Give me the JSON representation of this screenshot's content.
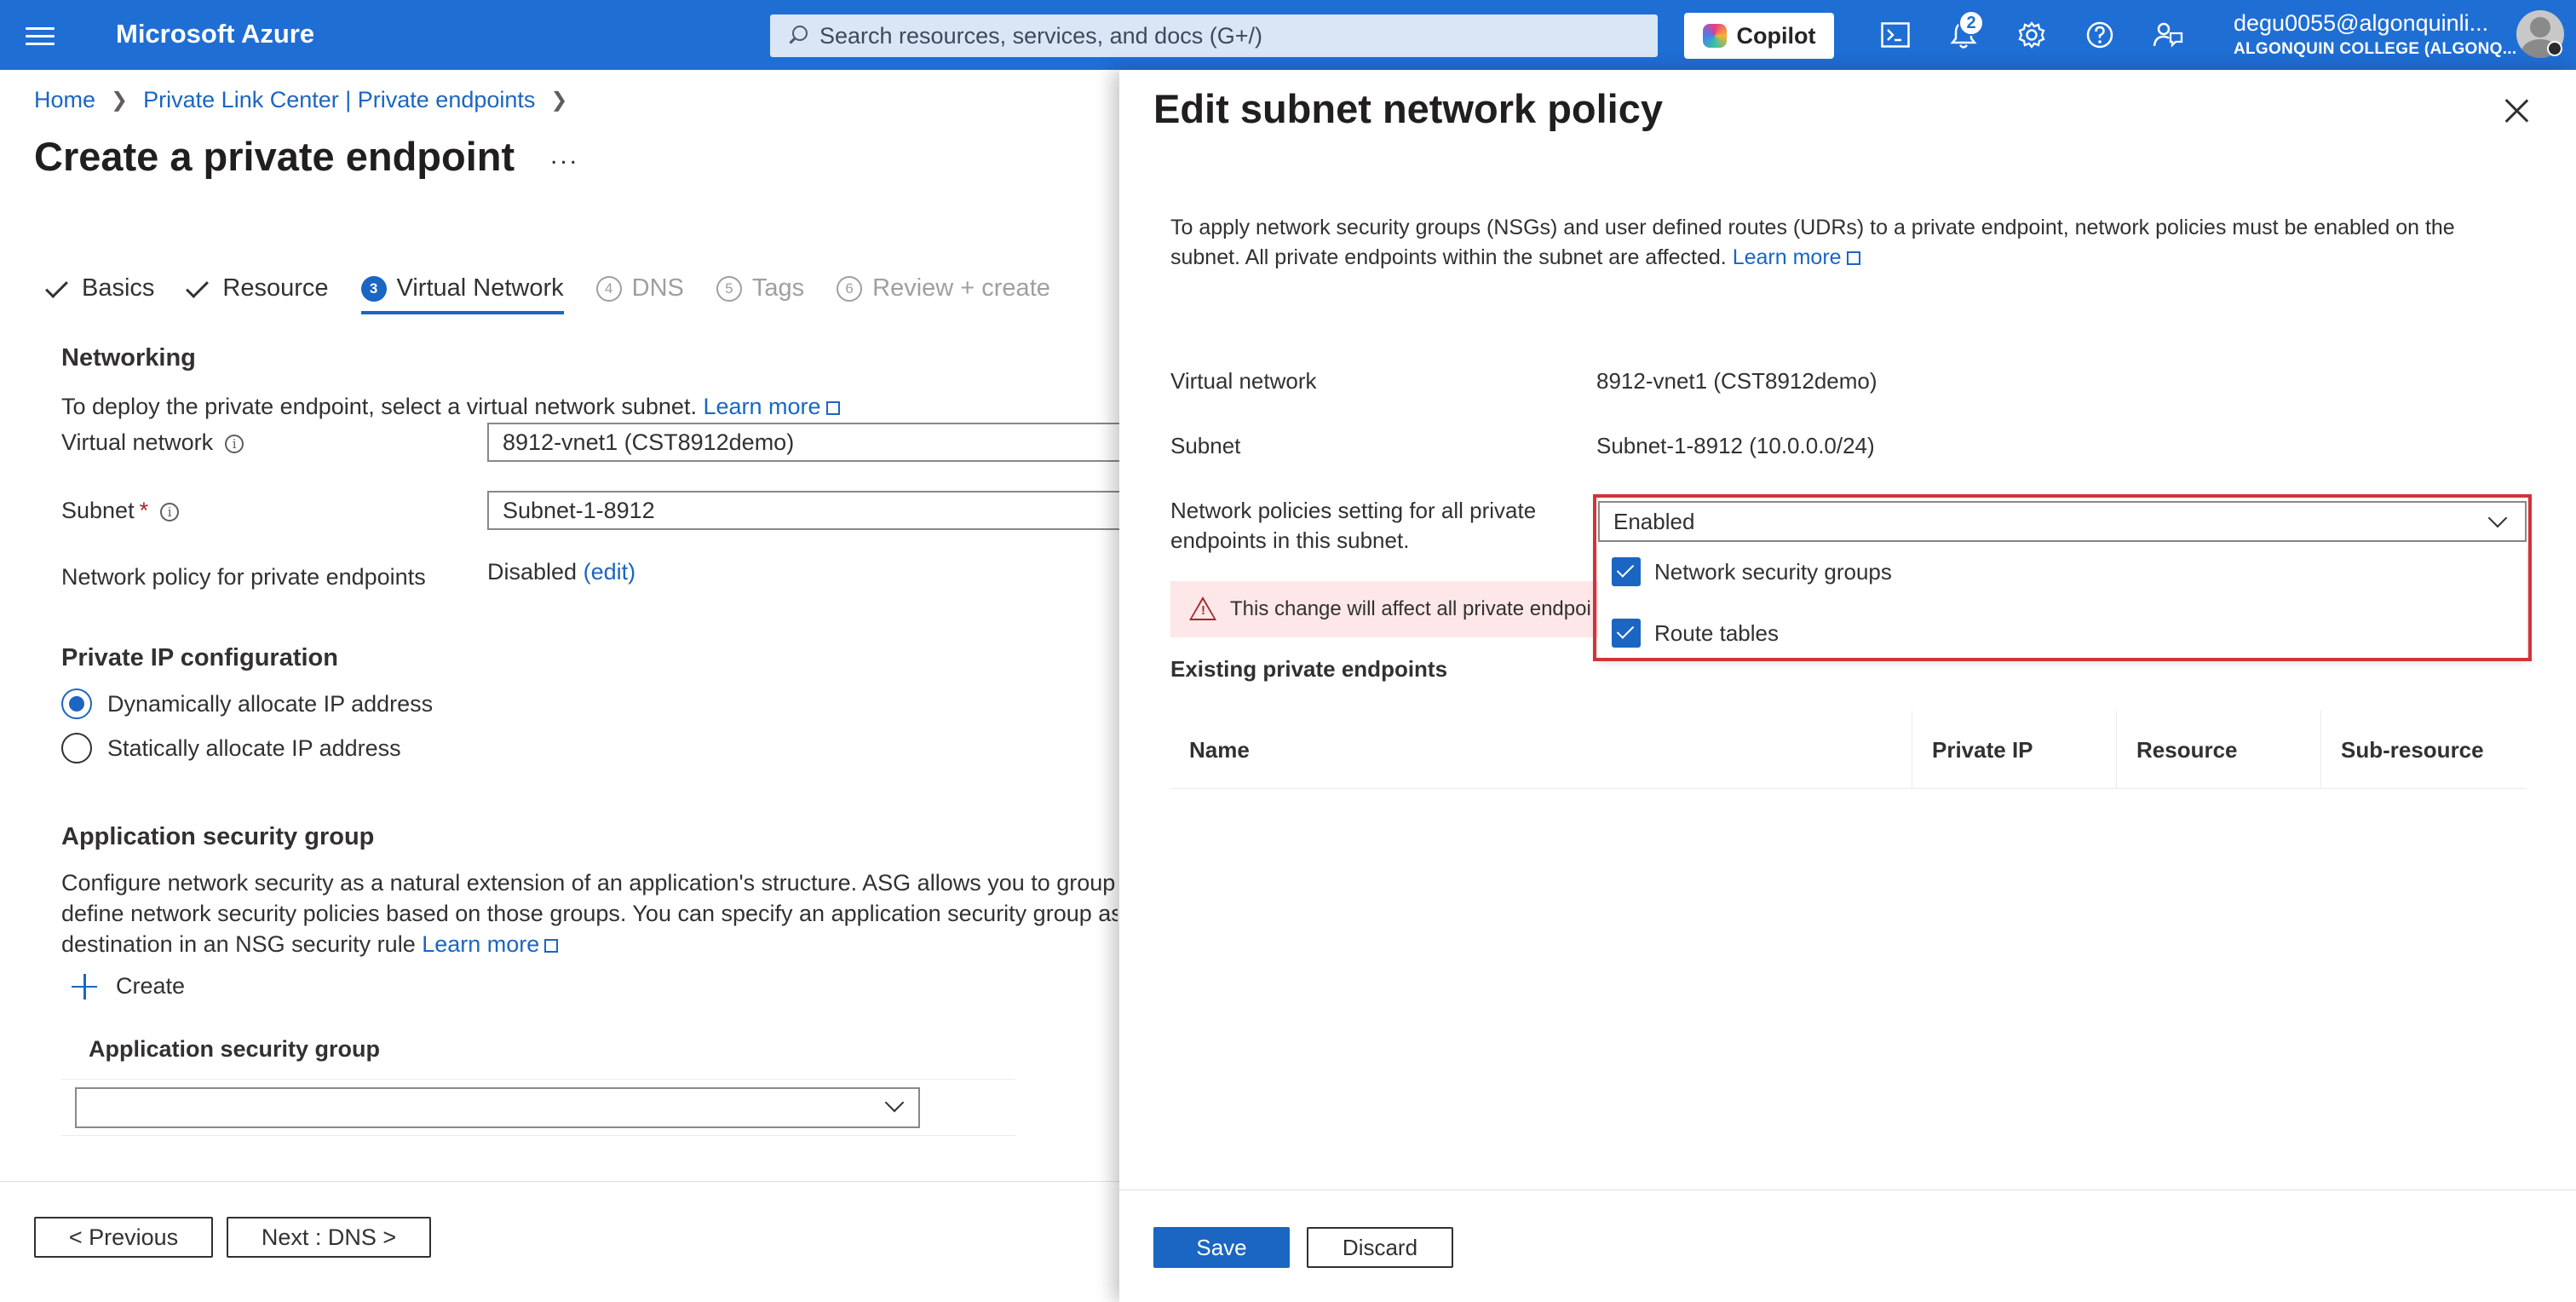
{
  "topbar": {
    "app_title": "Microsoft Azure",
    "search_placeholder": "Search resources, services, and docs (G+/)",
    "copilot_label": "Copilot",
    "notification_count": "2",
    "account_name": "degu0055@algonquinli...",
    "account_org": "ALGONQUIN COLLEGE (ALGONQ...",
    "icons": [
      "menu-icon",
      "search-icon",
      "copilot-icon",
      "cloud-shell-icon",
      "bell-icon",
      "gear-icon",
      "help-icon",
      "feedback-icon"
    ]
  },
  "breadcrumb": [
    {
      "label": "Home"
    },
    {
      "label": "Private Link Center | Private endpoints"
    }
  ],
  "page": {
    "title": "Create a private endpoint",
    "more": "..."
  },
  "tabs": [
    {
      "label": "Basics",
      "state": "done"
    },
    {
      "label": "Resource",
      "state": "done"
    },
    {
      "num": "3",
      "label": "Virtual Network",
      "state": "current"
    },
    {
      "num": "4",
      "label": "DNS",
      "state": "disabled"
    },
    {
      "num": "5",
      "label": "Tags",
      "state": "disabled"
    },
    {
      "num": "6",
      "label": "Review + create",
      "state": "disabled"
    }
  ],
  "networking": {
    "heading": "Networking",
    "desc": "To deploy the private endpoint, select a virtual network subnet.",
    "learn_more": "Learn more",
    "vnet_label": "Virtual network",
    "vnet_value": "8912-vnet1 (CST8912demo)",
    "subnet_label": "Subnet",
    "subnet_required": "*",
    "subnet_value": "Subnet-1-8912",
    "policy_label": "Network policy for private endpoints",
    "policy_value": "Disabled",
    "policy_edit": "(edit)"
  },
  "ip_config": {
    "heading": "Private IP configuration",
    "options": [
      {
        "label": "Dynamically allocate IP address",
        "selected": true
      },
      {
        "label": "Statically allocate IP address",
        "selected": false
      }
    ]
  },
  "asg": {
    "heading": "Application security group",
    "desc_line1": "Configure network security as a natural extension of an application's structure. ASG allows you to group virtu",
    "desc_line2": "define network security policies based on those groups. You can specify an application security group as the",
    "desc_line3": "destination in an NSG security rule",
    "learn_more": "Learn more",
    "create_label": "Create",
    "column_header": "Application security group",
    "select_value": ""
  },
  "footer": {
    "previous": "< Previous",
    "next": "Next : DNS >"
  },
  "panel": {
    "title": "Edit subnet network policy",
    "desc_line1": "To apply network security groups (NSGs) and user defined routes (UDRs) to a private endpoint, network policies must be enabled on the",
    "desc_line2": "subnet. All private endpoints within the subnet are affected.",
    "learn_more": "Learn more",
    "vnet_label": "Virtual network",
    "vnet_value": "8912-vnet1 (CST8912demo)",
    "subnet_label": "Subnet",
    "subnet_value": "Subnet-1-8912 (10.0.0.0/24)",
    "setting_label_line1": "Network policies setting for all private",
    "setting_label_line2": "endpoints in this subnet.",
    "setting_value": "Enabled",
    "options": [
      {
        "label": "Network security groups",
        "checked": true
      },
      {
        "label": "Route tables",
        "checked": true
      }
    ],
    "warning": "This change will affect all private endpoi",
    "existing_heading": "Existing private endpoints",
    "columns": [
      "Name",
      "Private IP",
      "Resource",
      "Sub-resource"
    ],
    "save": "Save",
    "discard": "Discard"
  },
  "colors": {
    "topbar": "#1f6ed4",
    "accent": "#1a66c2",
    "highlight_border": "#d13438",
    "warning_bg": "#fde7e9"
  }
}
